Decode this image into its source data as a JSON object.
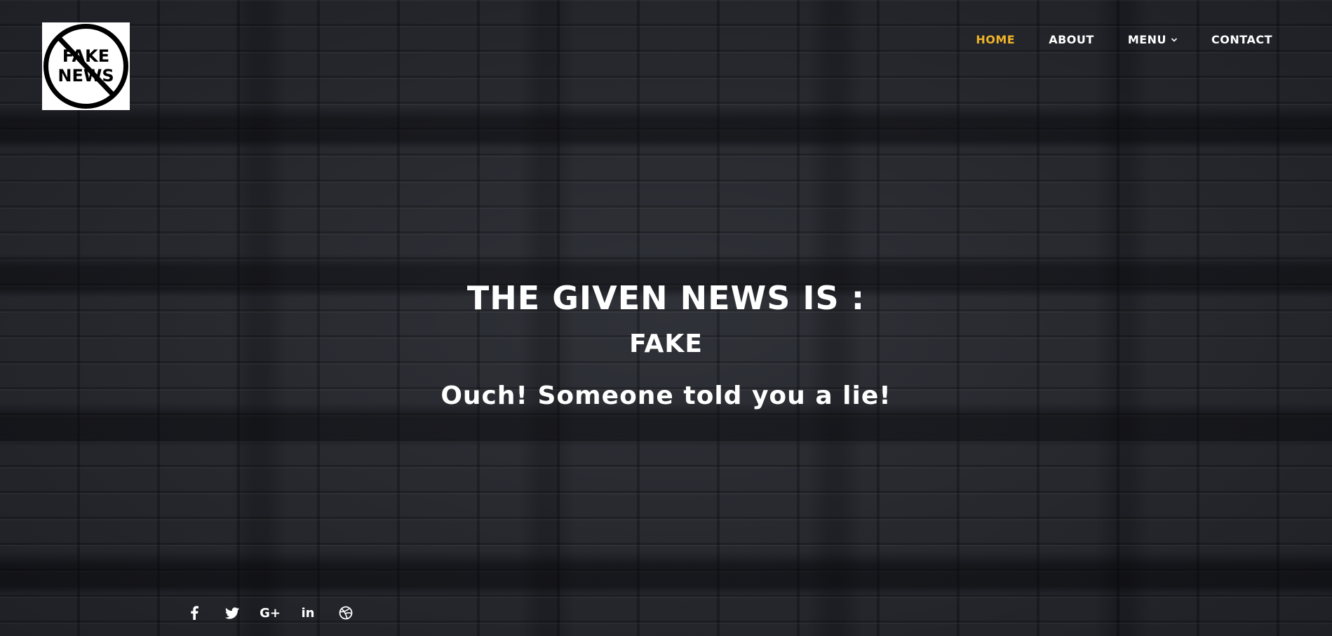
{
  "logo": {
    "line1": "FAKE",
    "line2": "NEWS"
  },
  "nav": {
    "items": [
      {
        "label": "HOME",
        "active": true
      },
      {
        "label": "ABOUT",
        "active": false
      },
      {
        "label": "MENU",
        "active": false
      },
      {
        "label": "CONTACT",
        "active": false
      }
    ],
    "active_color": "#f0b429"
  },
  "hero": {
    "heading": "THE GIVEN NEWS IS :",
    "result": "FAKE",
    "message": "Ouch! Someone told you a lie!"
  },
  "social": {
    "icons": [
      "facebook-icon",
      "twitter-icon",
      "google-plus-icon",
      "linkedin-icon",
      "dribbble-icon"
    ],
    "google_plus_text": "G+",
    "linkedin_text": "in"
  }
}
